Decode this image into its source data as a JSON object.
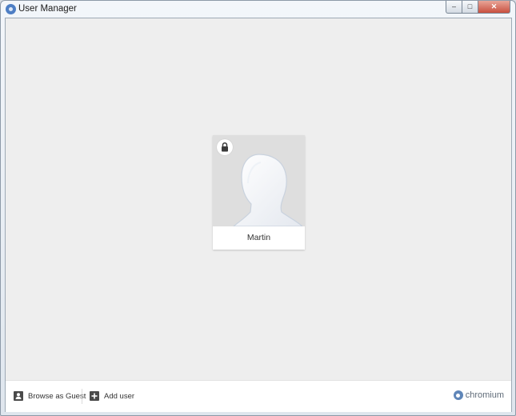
{
  "window": {
    "title": "User Manager",
    "controls": {
      "minimize": "–",
      "maximize": "□",
      "close": "✕"
    }
  },
  "profiles": [
    {
      "name": "Martin",
      "locked": true,
      "avatar_icon": "silhouette-head-icon"
    }
  ],
  "bottom_bar": {
    "browse_as_guest_label": "Browse as Guest",
    "add_user_label": "Add user",
    "brand_label": "chromium"
  },
  "colors": {
    "background": "#eeeeee",
    "card": "#ffffff",
    "avatar_bg": "#dedede",
    "brand": "#5f6b78"
  }
}
